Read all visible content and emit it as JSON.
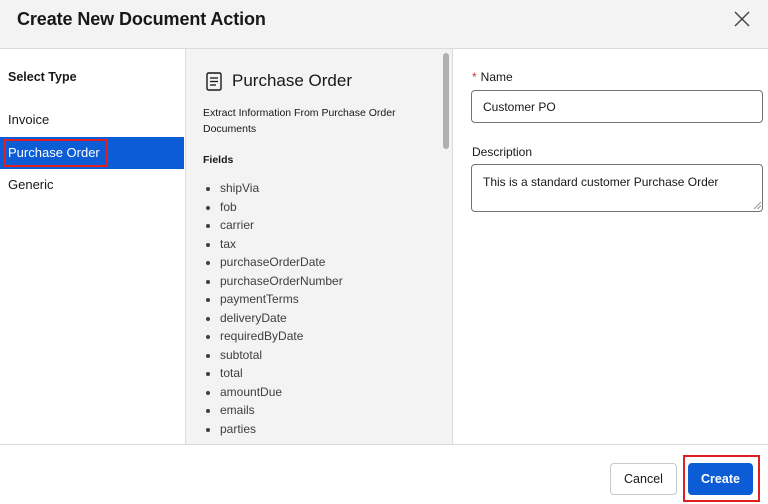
{
  "modal": {
    "title": "Create New Document Action"
  },
  "types": {
    "heading": "Select Type",
    "items": [
      {
        "label": "Invoice"
      },
      {
        "label": "Purchase Order",
        "selected": true
      },
      {
        "label": "Generic"
      }
    ]
  },
  "details": {
    "icon": "document-icon",
    "title": "Purchase Order",
    "description": "Extract Information From Purchase Order Documents",
    "fields_heading": "Fields",
    "fields": [
      "shipVia",
      "fob",
      "carrier",
      "tax",
      "purchaseOrderDate",
      "purchaseOrderNumber",
      "paymentTerms",
      "deliveryDate",
      "requiredByDate",
      "subtotal",
      "total",
      "amountDue",
      "emails",
      "parties"
    ]
  },
  "form": {
    "name_required_marker": "*",
    "name_label": "Name",
    "name_value": "Customer PO",
    "description_label": "Description",
    "description_value": "This is a standard customer Purchase Order"
  },
  "footer": {
    "cancel_label": "Cancel",
    "create_label": "Create"
  },
  "colors": {
    "accent": "#0b5cd5",
    "highlight": "#e02020",
    "panel": "#f3f3f3",
    "required": "#c23934"
  }
}
